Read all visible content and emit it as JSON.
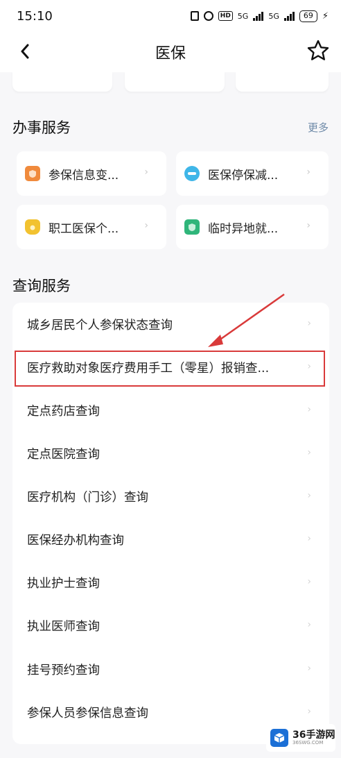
{
  "status_bar": {
    "time": "15:10",
    "hd_label": "HD",
    "signal1": "5G",
    "signal2": "5G",
    "battery": "69"
  },
  "nav": {
    "title": "医保"
  },
  "sections": {
    "services_title": "办事服务",
    "more_label": "更多",
    "query_title": "查询服务"
  },
  "services": [
    {
      "label": "参保信息变...",
      "icon": "orange-shield-icon",
      "color": "#f08a3c"
    },
    {
      "label": "医保停保减...",
      "icon": "blue-minus-icon",
      "color": "#3fb6e8"
    },
    {
      "label": "职工医保个...",
      "icon": "yellow-money-bag-icon",
      "color": "#f2c230"
    },
    {
      "label": "临时异地就...",
      "icon": "green-shield-icon",
      "color": "#2fb57a"
    }
  ],
  "queries": [
    {
      "label": "城乡居民个人参保状态查询"
    },
    {
      "label": "医疗救助对象医疗费用手工（零星）报销查..."
    },
    {
      "label": "定点药店查询"
    },
    {
      "label": "定点医院查询"
    },
    {
      "label": "医疗机构（门诊）查询"
    },
    {
      "label": "医保经办机构查询"
    },
    {
      "label": "执业护士查询"
    },
    {
      "label": "执业医师查询"
    },
    {
      "label": "挂号预约查询"
    },
    {
      "label": "参保人员参保信息查询"
    }
  ],
  "annotation": {
    "highlight_color": "#d93a3a"
  },
  "watermark": {
    "brand": "36手游网",
    "sub": "36SWG.COM"
  }
}
